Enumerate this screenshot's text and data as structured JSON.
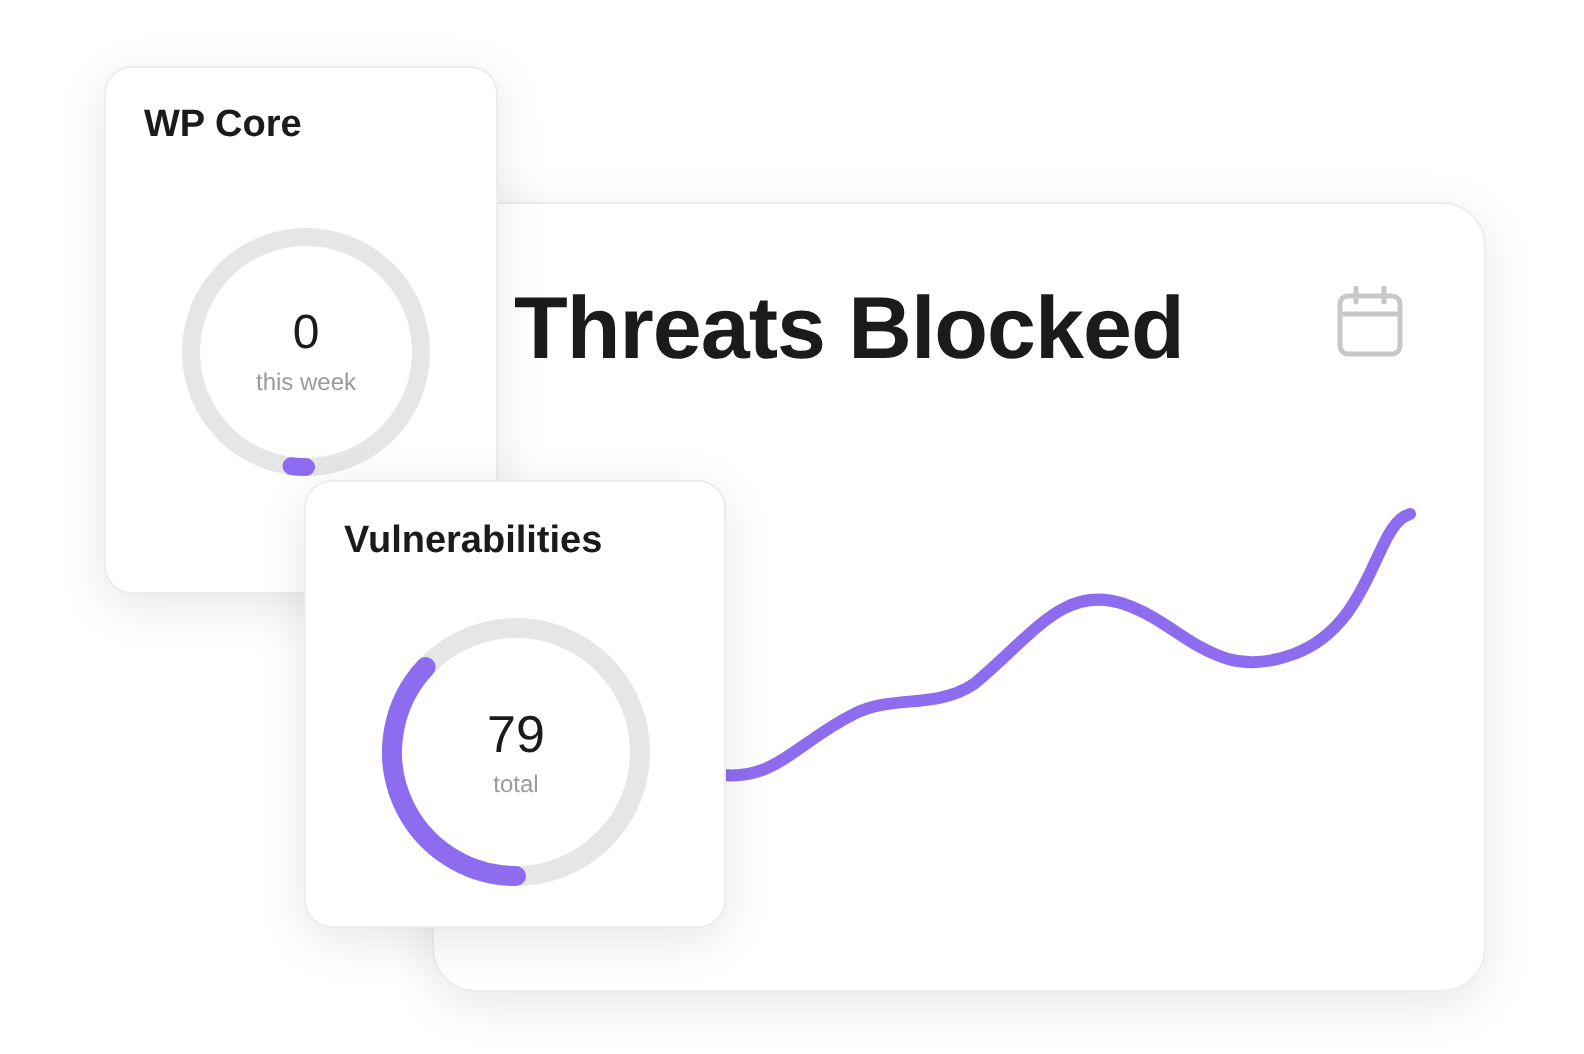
{
  "threats_card": {
    "title": "Threats Blocked"
  },
  "wp_core_card": {
    "title": "WP Core",
    "ring": {
      "value": "0",
      "caption": "this week"
    }
  },
  "vulnerabilities_card": {
    "title": "Vulnerabilities",
    "ring": {
      "value": "79",
      "caption": "total"
    }
  }
}
